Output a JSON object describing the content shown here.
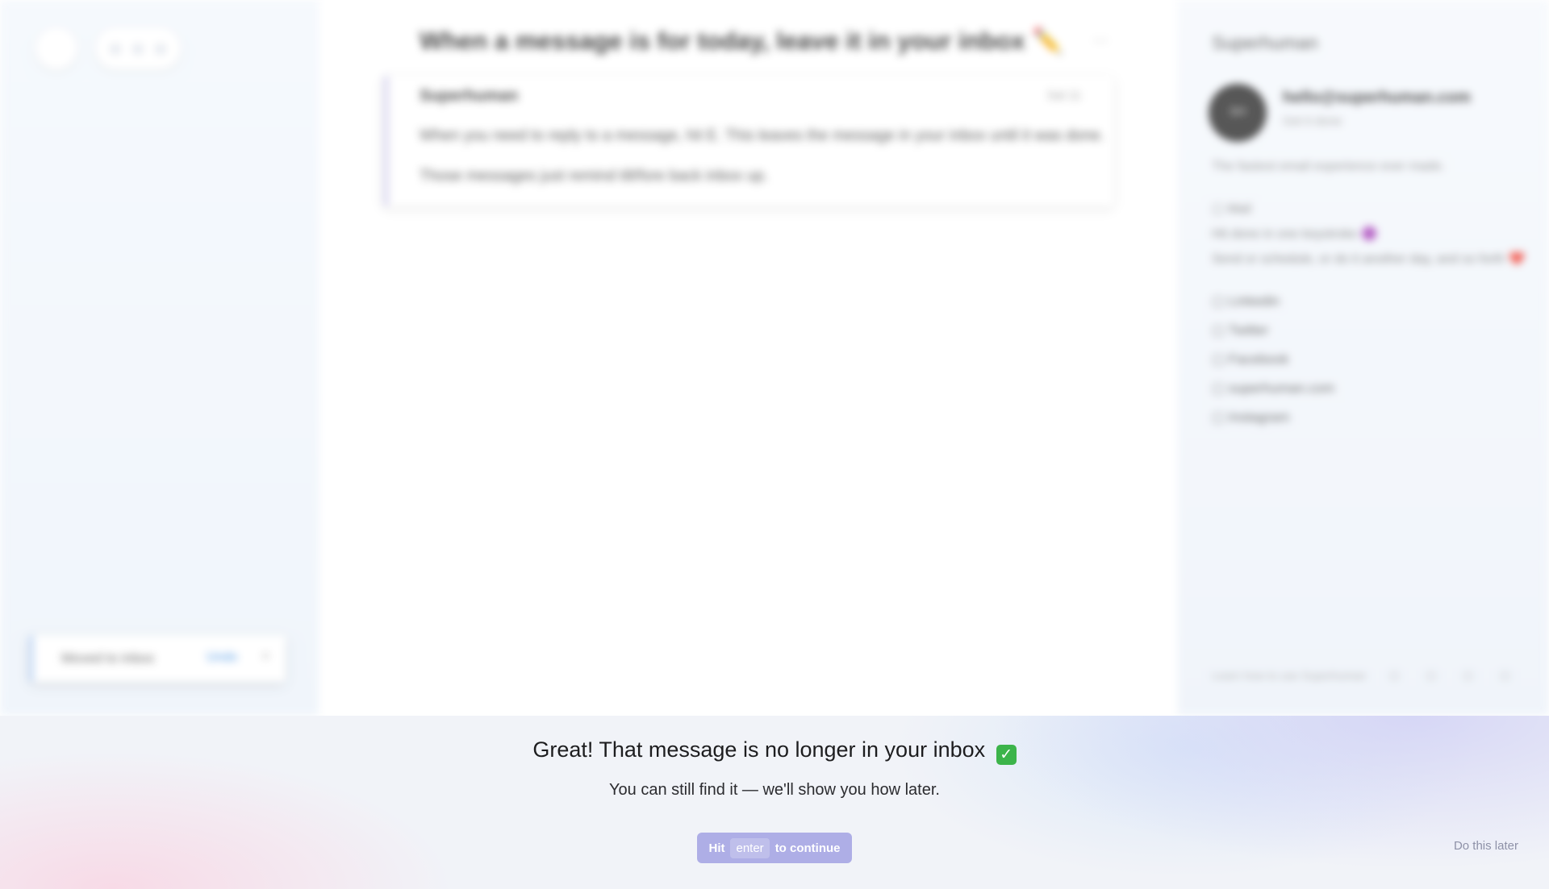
{
  "sidebar_left": {
    "toast": {
      "text": "Moved to inbox",
      "action": "Undo",
      "close": "×"
    }
  },
  "main": {
    "subject": "When a message is for today, leave it in your inbox ✏️",
    "subject_actions": "‹ › ⋯",
    "message": {
      "sender": "Superhuman",
      "time": "Sat 11",
      "line1": "When you need to reply to a message, hit E. This leaves the message in your inbox until it was done.",
      "line2": "Those messages just remind till/fore back inbox up."
    }
  },
  "sidebar_right": {
    "title": "Superhuman",
    "avatar_initials": "SH",
    "name": "hello@superhuman.com",
    "sub": "Get it done",
    "desc": "The fastest email experience ever made.",
    "lines": [
      "▢ Mail",
      "Hit done in one keystroke 🟣",
      "Send or schedule, or do it another day, and so forth ❤️"
    ],
    "links": [
      "▢ Linkedin",
      "▢ Twitter",
      "▢ Facebook",
      "▢ superhuman.com",
      "▢ Instagram"
    ],
    "footer": "Learn how to use Superhuman",
    "footer_icons": "◻ ◻ ◻ ◻"
  },
  "banner": {
    "headline": "Great! That message is no longer in your inbox",
    "headline_check": "✓",
    "subtext": "You can still find it — we'll show you how later.",
    "cta": {
      "prefix": "Hit",
      "key": "enter",
      "suffix": "to continue"
    },
    "skip": "Do this later"
  }
}
